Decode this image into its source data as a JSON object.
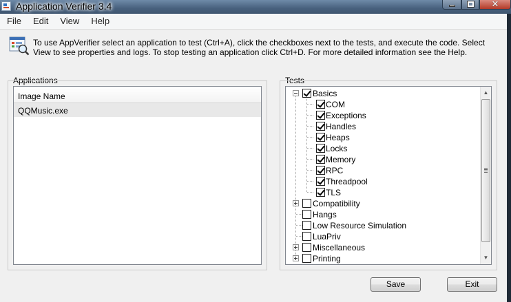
{
  "window": {
    "title": "Application Verifier 3.4"
  },
  "menu": {
    "items": [
      "File",
      "Edit",
      "View",
      "Help"
    ]
  },
  "info": {
    "icon": "appverifier-info-icon",
    "text": "To use AppVerifier select an application to test (Ctrl+A), click the checkboxes next to the tests, and execute the code. Select View to see properties and logs. To stop testing an application click Ctrl+D. For more detailed information see the Help."
  },
  "applications": {
    "group_label": "Applications",
    "column_header": "Image Name",
    "rows": [
      "QQMusic.exe"
    ]
  },
  "tests": {
    "group_label": "Tests",
    "basics": {
      "label": "Basics",
      "checked": true,
      "expanded": true,
      "children": [
        {
          "label": "COM",
          "checked": true
        },
        {
          "label": "Exceptions",
          "checked": true
        },
        {
          "label": "Handles",
          "checked": true
        },
        {
          "label": "Heaps",
          "checked": true
        },
        {
          "label": "Locks",
          "checked": true
        },
        {
          "label": "Memory",
          "checked": true
        },
        {
          "label": "RPC",
          "checked": true
        },
        {
          "label": "Threadpool",
          "checked": true
        },
        {
          "label": "TLS",
          "checked": true
        }
      ]
    },
    "others": [
      {
        "label": "Compatibility",
        "checked": false,
        "expandable": true
      },
      {
        "label": "Hangs",
        "checked": false,
        "expandable": false
      },
      {
        "label": "Low Resource Simulation",
        "checked": false,
        "expandable": false
      },
      {
        "label": "LuaPriv",
        "checked": false,
        "expandable": false
      },
      {
        "label": "Miscellaneous",
        "checked": false,
        "expandable": true
      },
      {
        "label": "Printing",
        "checked": false,
        "expandable": true
      }
    ]
  },
  "buttons": {
    "save": "Save",
    "exit": "Exit"
  }
}
